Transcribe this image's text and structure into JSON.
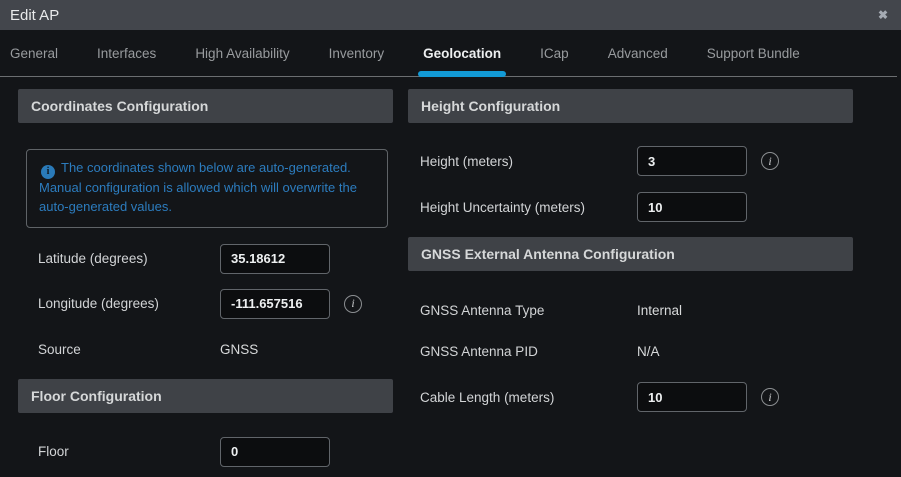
{
  "window": {
    "title": "Edit AP"
  },
  "icons": {
    "close": "✖",
    "info_filled": "i",
    "info_outline": "i"
  },
  "colors": {
    "accent_blue": "#129ad6",
    "note_blue": "#2c7cbe",
    "titlebar": "#43464c",
    "section_header": "#3f4247"
  },
  "tabs": [
    {
      "label": "General",
      "active": false
    },
    {
      "label": "Interfaces",
      "active": false
    },
    {
      "label": "High Availability",
      "active": false
    },
    {
      "label": "Inventory",
      "active": false
    },
    {
      "label": "Geolocation",
      "active": true
    },
    {
      "label": "ICap",
      "active": false
    },
    {
      "label": "Advanced",
      "active": false
    },
    {
      "label": "Support Bundle",
      "active": false
    }
  ],
  "coordinates": {
    "title": "Coordinates Configuration",
    "note": "The coordinates shown below are auto-generated. Manual configuration is allowed which will overwrite the auto-generated values.",
    "latitude": {
      "label": "Latitude (degrees)",
      "value": "35.18612"
    },
    "longitude": {
      "label": "Longitude (degrees)",
      "value": "-111.657516"
    },
    "source": {
      "label": "Source",
      "value": "GNSS"
    }
  },
  "floor": {
    "title": "Floor Configuration",
    "floor": {
      "label": "Floor",
      "value": "0"
    }
  },
  "height": {
    "title": "Height Configuration",
    "height": {
      "label": "Height (meters)",
      "value": "3"
    },
    "uncertainty": {
      "label": "Height Uncertainty (meters)",
      "value": "10"
    }
  },
  "gnss": {
    "title": "GNSS External Antenna Configuration",
    "antenna_type": {
      "label": "GNSS Antenna Type",
      "value": "Internal"
    },
    "antenna_pid": {
      "label": "GNSS Antenna PID",
      "value": "N/A"
    },
    "cable_length": {
      "label": "Cable Length (meters)",
      "value": "10"
    }
  }
}
